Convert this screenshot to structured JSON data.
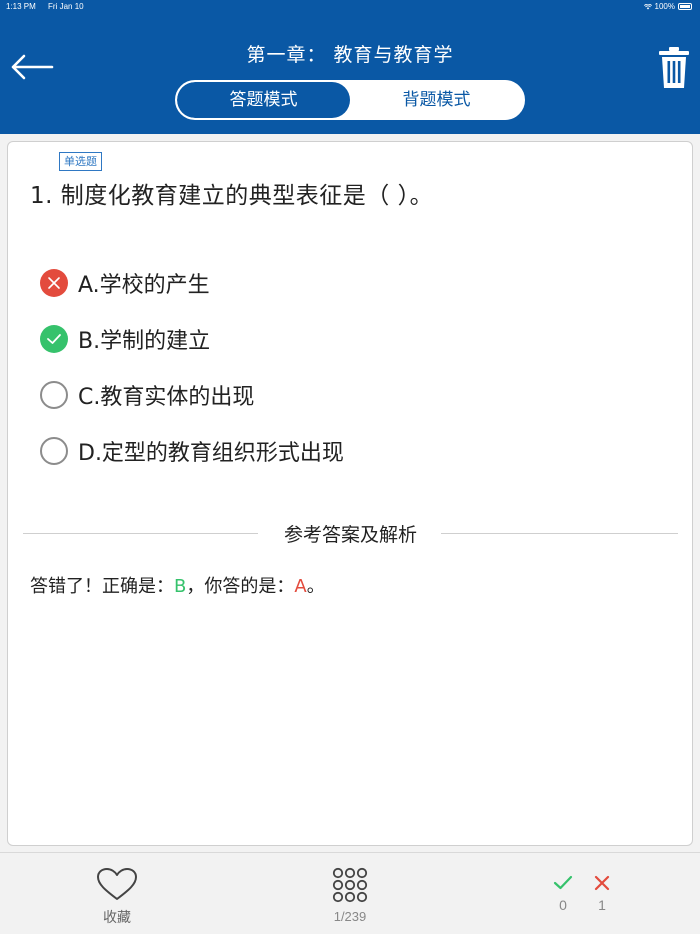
{
  "status_bar": {
    "time": "1:13 PM",
    "date": "Fri Jan 10",
    "battery": "100%"
  },
  "header": {
    "title": "第一章：  教育与教育学",
    "tabs": [
      {
        "label": "答题模式",
        "active": true
      },
      {
        "label": "背题模式",
        "active": false
      }
    ]
  },
  "question": {
    "type_tag": "单选题",
    "text": "1. 制度化教育建立的典型表征是（  ）。",
    "options": [
      {
        "label": "A.学校的产生",
        "state": "wrong"
      },
      {
        "label": "B.学制的建立",
        "state": "correct"
      },
      {
        "label": "C.教育实体的出现",
        "state": "none"
      },
      {
        "label": "D.定型的教育组织形式出现",
        "state": "none"
      }
    ]
  },
  "analysis": {
    "heading": "参考答案及解析",
    "prefix": "答错了！正确是：",
    "correct_answer": "B",
    "middle": "，你答的是：",
    "user_answer": "A",
    "suffix": "。"
  },
  "footer": {
    "favorite_label": "收藏",
    "progress": "1/239",
    "correct_count": "0",
    "wrong_count": "1"
  },
  "colors": {
    "brand": "#0a58a5",
    "correct": "#36c26c",
    "wrong": "#e34b3d"
  }
}
